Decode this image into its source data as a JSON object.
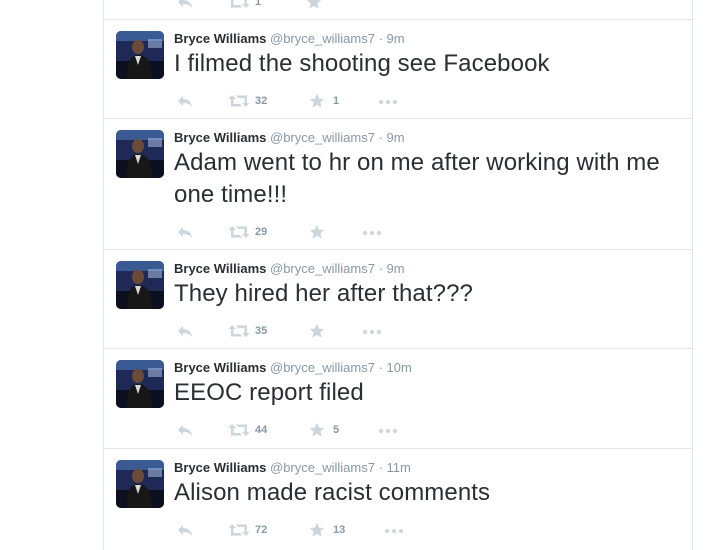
{
  "tweets": [
    {
      "name": "",
      "handle": "",
      "sep": "",
      "time": "",
      "text": "",
      "retweets": "1",
      "favorites": ""
    },
    {
      "name": "Bryce Williams",
      "handle": "@bryce_williams7",
      "sep": "·",
      "time": "9m",
      "text": "I filmed the shooting see Facebook",
      "retweets": "32",
      "favorites": "1"
    },
    {
      "name": "Bryce Williams",
      "handle": "@bryce_williams7",
      "sep": "·",
      "time": "9m",
      "text": "Adam went to hr on me after working with me one time!!!",
      "retweets": "29",
      "favorites": ""
    },
    {
      "name": "Bryce Williams",
      "handle": "@bryce_williams7",
      "sep": "·",
      "time": "9m",
      "text": "They hired her after that???",
      "retweets": "35",
      "favorites": ""
    },
    {
      "name": "Bryce Williams",
      "handle": "@bryce_williams7",
      "sep": "·",
      "time": "10m",
      "text": "EEOC report filed",
      "retweets": "44",
      "favorites": "5"
    },
    {
      "name": "Bryce Williams",
      "handle": "@bryce_williams7",
      "sep": "·",
      "time": "11m",
      "text": "Alison made racist comments",
      "retweets": "72",
      "favorites": "13"
    }
  ],
  "icons": {
    "reply": "reply-icon",
    "retweet": "retweet-icon",
    "favorite": "star-icon",
    "more": "more-icon"
  },
  "colors": {
    "name": "#292f33",
    "meta": "#8899a6",
    "icon": "#ccd6dd",
    "border": "#e1e8ed"
  }
}
